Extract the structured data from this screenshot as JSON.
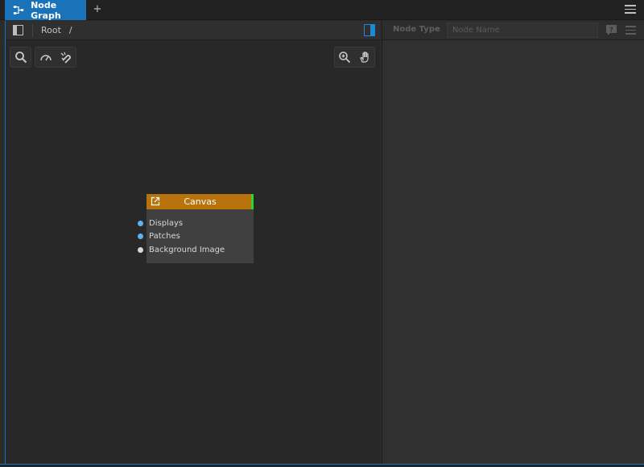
{
  "tabs": [
    {
      "label": "Node Graph",
      "active": true,
      "icon": "node-graph-icon"
    }
  ],
  "tabbar": {
    "add_label": "+"
  },
  "breadcrumb": {
    "root": "Root",
    "separator": "/"
  },
  "node": {
    "title": "Canvas",
    "header_color": "#b8730c",
    "status_color": "#2bd62b",
    "ports": [
      {
        "label": "Displays",
        "color": "#5ab4f0"
      },
      {
        "label": "Patches",
        "color": "#5ab4f0"
      },
      {
        "label": "Background Image",
        "color": "#d8d8d8"
      }
    ]
  },
  "inspector": {
    "node_type_label": "Node Type",
    "node_name_placeholder": "Node Name",
    "node_name_value": ""
  },
  "colors": {
    "accent": "#1a72b8",
    "toggle_active": "#1e8ad6"
  }
}
